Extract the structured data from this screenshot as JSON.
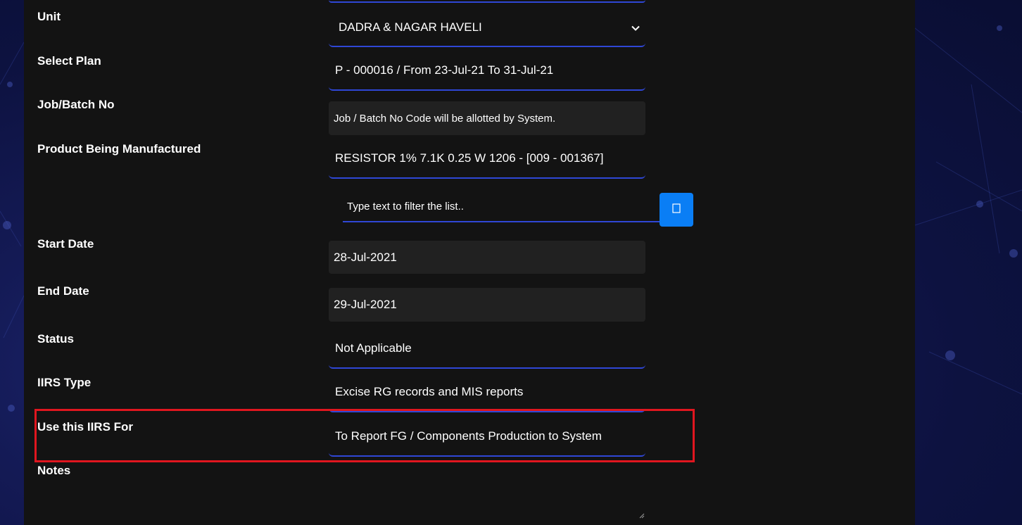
{
  "form": {
    "unit": {
      "label": "Unit",
      "value": "DADRA & NAGAR HAVELI"
    },
    "select_plan": {
      "label": "Select Plan",
      "value": "P - 000016 / From 23-Jul-21 To 31-Jul-21"
    },
    "job_batch_no": {
      "label": "Job/Batch No",
      "value": "Job / Batch No Code will be allotted by System."
    },
    "product": {
      "label": "Product Being Manufactured",
      "value": "RESISTOR 1% 7.1K 0.25 W 1206 - [009 - 001367]",
      "filter_placeholder": "Type text to filter the list.."
    },
    "start_date": {
      "label": "Start Date",
      "value": "28-Jul-2021"
    },
    "end_date": {
      "label": "End Date",
      "value": "29-Jul-2021"
    },
    "status": {
      "label": "Status",
      "value": "Not Applicable"
    },
    "iirs_type": {
      "label": "IIRS Type",
      "value": "Excise RG records and MIS reports"
    },
    "use_iirs_for": {
      "label": "Use this IIRS For",
      "value": "To Report FG / Components Production to System"
    },
    "notes": {
      "label": "Notes",
      "value": ""
    }
  },
  "colors": {
    "panel_bg": "#131313",
    "underline": "#2f47d6",
    "filter_button": "#0a7ef5",
    "highlight_border": "#e0161f"
  },
  "icons": {
    "dropdown": "chevron-down-icon",
    "filter_button": "filter-icon"
  }
}
